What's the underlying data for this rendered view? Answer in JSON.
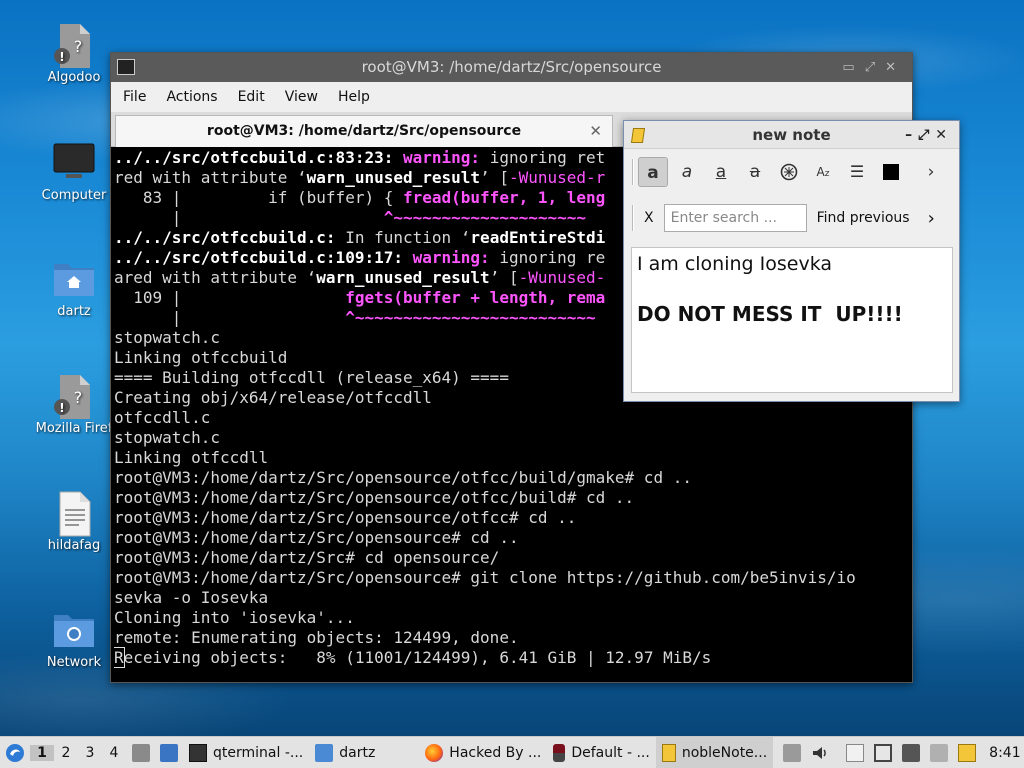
{
  "desktop": {
    "icons": [
      {
        "label": "Algodoo",
        "icon": "broken-file-icon"
      },
      {
        "label": "Computer",
        "icon": "computer-icon"
      },
      {
        "label": "dartz",
        "icon": "home-folder-icon"
      },
      {
        "label": "Mozilla Firef",
        "icon": "broken-file-icon"
      },
      {
        "label": "hildafag",
        "icon": "text-file-icon"
      },
      {
        "label": "Network",
        "icon": "network-folder-icon"
      }
    ]
  },
  "terminal": {
    "title": "root@VM3: /home/dartz/Src/opensource",
    "menu": [
      "File",
      "Actions",
      "Edit",
      "View",
      "Help"
    ],
    "tab_title": "root@VM3: /home/dartz/Src/opensource",
    "tab_close": "✕",
    "lines": [
      {
        "a": "../../src/otfccbuild.c:83:23: ",
        "b": "warning: ",
        "c": "ignoring ret"
      },
      {
        "a": "red with attribute ‘",
        "b": "warn_unused_result",
        "c": "’ [",
        "d": "-Wunused-r"
      },
      {
        "a": "   83 |         if (buffer) { ",
        "b": "fread(buffer, 1, leng"
      },
      {
        "a": "      |                     ",
        "b": "^~~~~~~~~~~~~~~~~~~~~"
      },
      {
        "a": "../../src/otfccbuild.c: ",
        "c": "In function ‘",
        "b": "readEntireStdi"
      },
      {
        "a": "../../src/otfccbuild.c:109:17: ",
        "b": "warning: ",
        "c": "ignoring re"
      },
      {
        "a": "ared with attribute ‘",
        "b": "warn_unused_result",
        "c": "’ [",
        "d": "-Wunused-"
      },
      {
        "a": "  109 |                 ",
        "b": "fgets(buffer + length, rema"
      },
      {
        "a": "      |                 ",
        "b": "^~~~~~~~~~~~~~~~~~~~~~~~~~"
      },
      {
        "a": "stopwatch.c"
      },
      {
        "a": "Linking otfccbuild"
      },
      {
        "a": "==== Building otfccdll (release_x64) ===="
      },
      {
        "a": "Creating obj/x64/release/otfccdll"
      },
      {
        "a": "otfccdll.c"
      },
      {
        "a": "stopwatch.c"
      },
      {
        "a": "Linking otfccdll"
      },
      {
        "a": "root@VM3:/home/dartz/Src/opensource/otfcc/build/gmake# cd .."
      },
      {
        "a": "root@VM3:/home/dartz/Src/opensource/otfcc/build# cd .."
      },
      {
        "a": "root@VM3:/home/dartz/Src/opensource/otfcc# cd .."
      },
      {
        "a": "root@VM3:/home/dartz/Src/opensource# cd .."
      },
      {
        "a": "root@VM3:/home/dartz/Src# cd opensource/"
      },
      {
        "a": "root@VM3:/home/dartz/Src/opensource# git clone https://github.com/be5invis/io"
      },
      {
        "a": "sevka -o Iosevka"
      },
      {
        "a": "Cloning into 'iosevka'..."
      },
      {
        "a": "remote: Enumerating objects: 124499, done."
      },
      {
        "a": "Receiving objects:   8% (11001/124499), 6.41 GiB | 12.97 MiB/s"
      }
    ]
  },
  "note": {
    "title": "new note",
    "toolbar": [
      "bold-a",
      "italic-a",
      "underline-a",
      "strike-a",
      "link",
      "highlight",
      "list",
      "color",
      "more"
    ],
    "close_search": "X",
    "search_placeholder": "Enter search ...",
    "find_previous": "Find previous",
    "more_arrow": ">",
    "content_line1": "I am cloning Iosevka",
    "content_line2": "DO NOT MESS IT  UP!!!!"
  },
  "taskbar": {
    "workspaces": [
      "1",
      "2",
      "3",
      "4"
    ],
    "active_workspace": "1",
    "tasks": [
      {
        "label": "qterminal -...",
        "icon": "terminal-icon"
      },
      {
        "label": "dartz",
        "icon": "folder-icon"
      },
      {
        "label": "Hacked By ...",
        "icon": "firefox-icon"
      },
      {
        "label": "Default - ...",
        "icon": "wine-icon"
      },
      {
        "label": "nobleNote...",
        "icon": "note-icon"
      }
    ],
    "clock": "8:41"
  }
}
